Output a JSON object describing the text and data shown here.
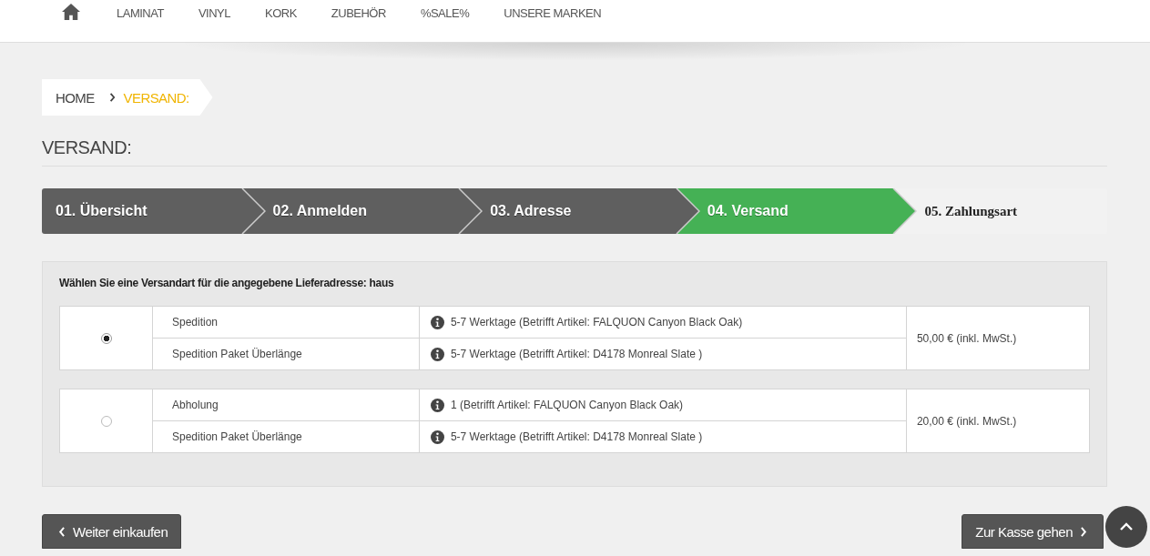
{
  "nav": {
    "items": [
      {
        "kind": "home"
      },
      {
        "kind": "text",
        "label": "LAMINAT"
      },
      {
        "kind": "text",
        "label": "VINYL"
      },
      {
        "kind": "text",
        "label": "KORK"
      },
      {
        "kind": "text",
        "label": "ZUBEHÖR"
      },
      {
        "kind": "text",
        "label": "%SALE%"
      },
      {
        "kind": "text",
        "label": "UNSERE MARKEN"
      }
    ]
  },
  "breadcrumb": [
    {
      "label": "HOME",
      "current": false
    },
    {
      "label": "VERSAND:",
      "current": true
    }
  ],
  "page_title": "VERSAND:",
  "steps": [
    {
      "label": "01. Übersicht",
      "completed": true,
      "selected": false
    },
    {
      "label": "02. Anmelden",
      "completed": true,
      "selected": false
    },
    {
      "label": "03. Adresse",
      "completed": true,
      "selected": false
    },
    {
      "label": "04. Versand",
      "completed": false,
      "selected": true
    },
    {
      "label": "05. Zahlungsart",
      "completed": false,
      "selected": false
    }
  ],
  "shipping": {
    "prompt": "Wählen Sie eine Versandart für die angegebene Lieferadresse: haus",
    "options": [
      {
        "selected": true,
        "price": "50,00 € (inkl. MwSt.)",
        "lines": [
          {
            "name": "Spedition",
            "info": "5-7 Werktage (Betrifft Artikel: FALQUON Canyon Black Oak)"
          },
          {
            "name": "Spedition Paket Überlänge",
            "info": "5-7 Werktage (Betrifft Artikel: D4178 Monreal Slate )"
          }
        ]
      },
      {
        "selected": false,
        "price": "20,00 € (inkl. MwSt.)",
        "lines": [
          {
            "name": "Abholung",
            "info": "1 (Betrifft Artikel: FALQUON Canyon Black Oak)"
          },
          {
            "name": "Spedition Paket Überlänge",
            "info": "5-7 Werktage (Betrifft Artikel: D4178 Monreal Slate )"
          }
        ]
      }
    ]
  },
  "buttons": {
    "back": "Weiter einkaufen",
    "next": "Zur Kasse gehen"
  }
}
